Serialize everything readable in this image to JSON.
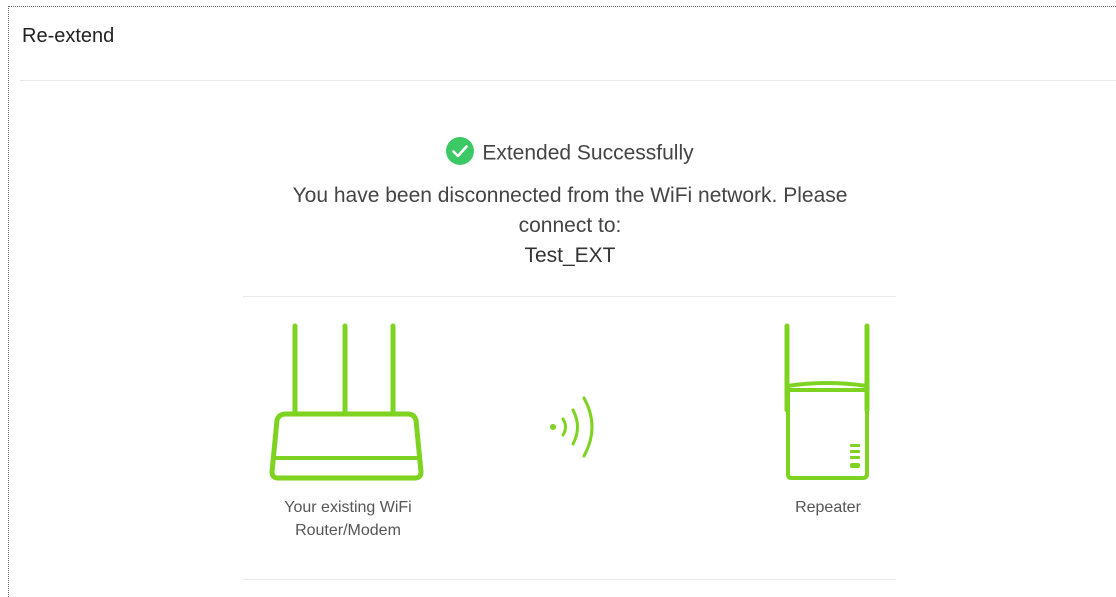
{
  "header": {
    "title": "Re-extend"
  },
  "status": {
    "title": "Extended Successfully",
    "message": "You have been disconnected from the WiFi network. Please connect to:",
    "ssid": "Test_EXT",
    "icon": "check-circle-icon",
    "icon_color": "#3cc864"
  },
  "diagram": {
    "accent_color": "#7ed321",
    "router_label_line1": "Your existing WiFi",
    "router_label_line2": "Router/Modem",
    "repeater_label": "Repeater",
    "router_icon": "router-icon",
    "signal_icon": "wifi-signal-icon",
    "repeater_icon": "repeater-icon"
  }
}
